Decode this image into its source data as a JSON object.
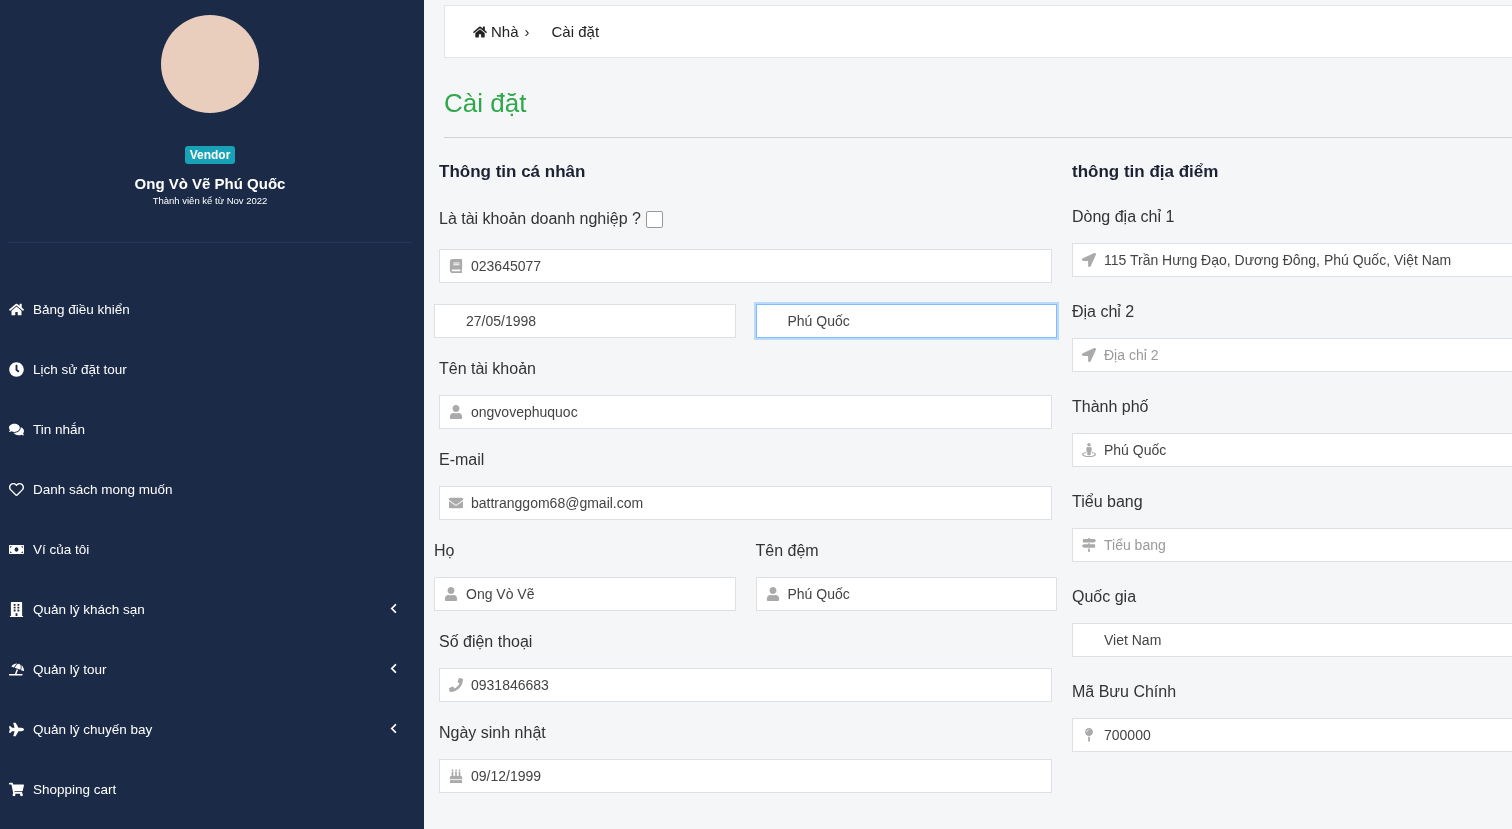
{
  "sidebar": {
    "badge": "Vendor",
    "user_name": "Ong Vò Vẽ Phú Quốc",
    "member_since": "Thành viên kể từ Nov 2022",
    "items": [
      {
        "label": "Bảng điều khiển",
        "expandable": false
      },
      {
        "label": "Lịch sử đặt tour",
        "expandable": false
      },
      {
        "label": "Tin nhắn",
        "expandable": false
      },
      {
        "label": "Danh sách mong muốn",
        "expandable": false
      },
      {
        "label": "Ví của tôi",
        "expandable": false
      },
      {
        "label": "Quản lý khách sạn",
        "expandable": true
      },
      {
        "label": "Quản lý tour",
        "expandable": true
      },
      {
        "label": "Quản lý chuyến bay",
        "expandable": true
      },
      {
        "label": "Shopping cart",
        "expandable": false
      }
    ]
  },
  "breadcrumb": [
    {
      "label": "Nhà",
      "kind": "home",
      "separator": "›"
    },
    {
      "label": "Cài đặt",
      "kind": "current"
    }
  ],
  "page_title": "Cài đặt",
  "personal": {
    "heading": "Thông tin cá nhân",
    "business_account": {
      "label": "Là tài khoản doanh nghiệp ?",
      "checked": false
    },
    "rows": [
      {
        "fields": [
          {
            "kind": "tax_id",
            "value": "023645077",
            "focused": false
          }
        ]
      },
      {
        "fields": [
          {
            "kind": "date",
            "value": "27/05/1998",
            "focused": false
          },
          {
            "kind": "plain",
            "value": "Phú Quốc",
            "focused": true
          }
        ]
      },
      {
        "fields": [
          {
            "kind": "user",
            "label": "Tên tài khoản",
            "value": "ongvovephuquoc",
            "focused": false
          }
        ]
      },
      {
        "fields": [
          {
            "kind": "email",
            "label": "E-mail",
            "value": "battranggom68@gmail.com",
            "focused": false
          }
        ]
      },
      {
        "fields": [
          {
            "kind": "user",
            "label": "Họ",
            "value": "Ong Vò Vẽ",
            "focused": false
          },
          {
            "kind": "user",
            "label": "Tên đệm",
            "value": "Phú Quốc",
            "focused": false
          }
        ]
      },
      {
        "fields": [
          {
            "kind": "phone",
            "label": "Số điện thoại",
            "value": "0931846683",
            "focused": false
          }
        ]
      },
      {
        "fields": [
          {
            "kind": "birthday",
            "label": "Ngày sinh nhật",
            "value": "09/12/1999",
            "focused": false
          }
        ]
      }
    ]
  },
  "location": {
    "heading": "thông tin địa điểm",
    "fields": [
      {
        "kind": "address",
        "label": "Dòng địa chỉ 1",
        "value": "115 Trần Hưng Đạo, Dương Đông, Phú Quốc, Việt Nam"
      },
      {
        "kind": "address",
        "label": "Địa chỉ 2",
        "placeholder": "Địa chỉ 2"
      },
      {
        "kind": "city",
        "label": "Thành phố",
        "value": "Phú Quốc"
      },
      {
        "kind": "state",
        "label": "Tiểu bang",
        "placeholder": "Tiểu bang"
      },
      {
        "kind": "country",
        "label": "Quốc gia",
        "value": "Viet Nam"
      },
      {
        "kind": "postal",
        "label": "Mã Bưu Chính",
        "value": "700000"
      }
    ]
  }
}
